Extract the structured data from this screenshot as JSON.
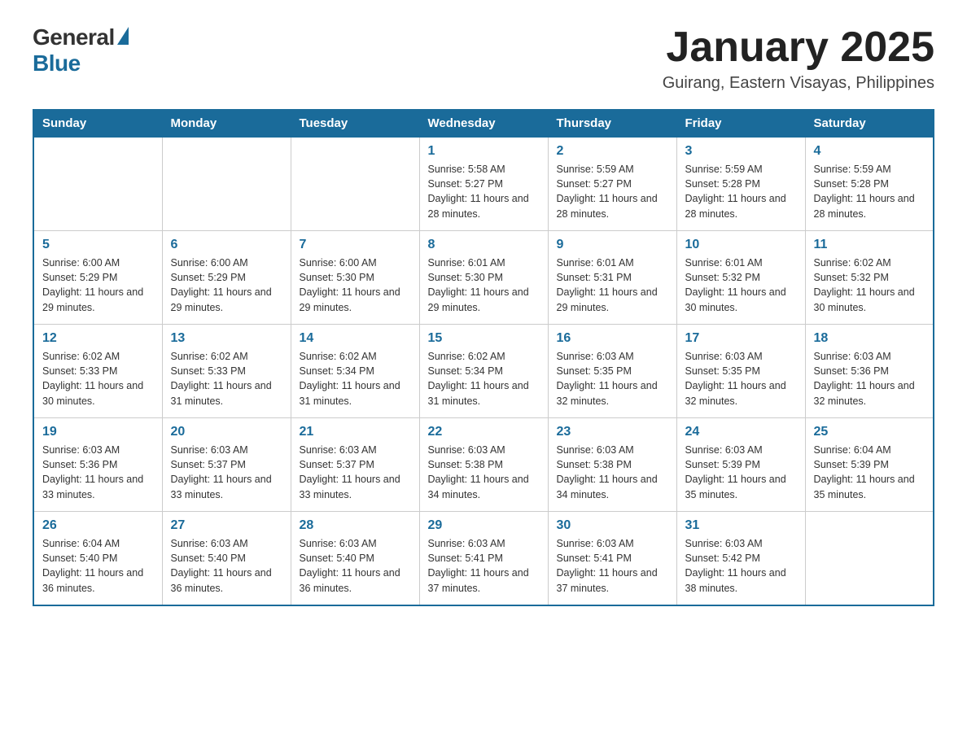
{
  "header": {
    "logo_general": "General",
    "logo_blue": "Blue",
    "title": "January 2025",
    "subtitle": "Guirang, Eastern Visayas, Philippines"
  },
  "days_of_week": [
    "Sunday",
    "Monday",
    "Tuesday",
    "Wednesday",
    "Thursday",
    "Friday",
    "Saturday"
  ],
  "weeks": [
    [
      {
        "day": "",
        "info": ""
      },
      {
        "day": "",
        "info": ""
      },
      {
        "day": "",
        "info": ""
      },
      {
        "day": "1",
        "info": "Sunrise: 5:58 AM\nSunset: 5:27 PM\nDaylight: 11 hours and 28 minutes."
      },
      {
        "day": "2",
        "info": "Sunrise: 5:59 AM\nSunset: 5:27 PM\nDaylight: 11 hours and 28 minutes."
      },
      {
        "day": "3",
        "info": "Sunrise: 5:59 AM\nSunset: 5:28 PM\nDaylight: 11 hours and 28 minutes."
      },
      {
        "day": "4",
        "info": "Sunrise: 5:59 AM\nSunset: 5:28 PM\nDaylight: 11 hours and 28 minutes."
      }
    ],
    [
      {
        "day": "5",
        "info": "Sunrise: 6:00 AM\nSunset: 5:29 PM\nDaylight: 11 hours and 29 minutes."
      },
      {
        "day": "6",
        "info": "Sunrise: 6:00 AM\nSunset: 5:29 PM\nDaylight: 11 hours and 29 minutes."
      },
      {
        "day": "7",
        "info": "Sunrise: 6:00 AM\nSunset: 5:30 PM\nDaylight: 11 hours and 29 minutes."
      },
      {
        "day": "8",
        "info": "Sunrise: 6:01 AM\nSunset: 5:30 PM\nDaylight: 11 hours and 29 minutes."
      },
      {
        "day": "9",
        "info": "Sunrise: 6:01 AM\nSunset: 5:31 PM\nDaylight: 11 hours and 29 minutes."
      },
      {
        "day": "10",
        "info": "Sunrise: 6:01 AM\nSunset: 5:32 PM\nDaylight: 11 hours and 30 minutes."
      },
      {
        "day": "11",
        "info": "Sunrise: 6:02 AM\nSunset: 5:32 PM\nDaylight: 11 hours and 30 minutes."
      }
    ],
    [
      {
        "day": "12",
        "info": "Sunrise: 6:02 AM\nSunset: 5:33 PM\nDaylight: 11 hours and 30 minutes."
      },
      {
        "day": "13",
        "info": "Sunrise: 6:02 AM\nSunset: 5:33 PM\nDaylight: 11 hours and 31 minutes."
      },
      {
        "day": "14",
        "info": "Sunrise: 6:02 AM\nSunset: 5:34 PM\nDaylight: 11 hours and 31 minutes."
      },
      {
        "day": "15",
        "info": "Sunrise: 6:02 AM\nSunset: 5:34 PM\nDaylight: 11 hours and 31 minutes."
      },
      {
        "day": "16",
        "info": "Sunrise: 6:03 AM\nSunset: 5:35 PM\nDaylight: 11 hours and 32 minutes."
      },
      {
        "day": "17",
        "info": "Sunrise: 6:03 AM\nSunset: 5:35 PM\nDaylight: 11 hours and 32 minutes."
      },
      {
        "day": "18",
        "info": "Sunrise: 6:03 AM\nSunset: 5:36 PM\nDaylight: 11 hours and 32 minutes."
      }
    ],
    [
      {
        "day": "19",
        "info": "Sunrise: 6:03 AM\nSunset: 5:36 PM\nDaylight: 11 hours and 33 minutes."
      },
      {
        "day": "20",
        "info": "Sunrise: 6:03 AM\nSunset: 5:37 PM\nDaylight: 11 hours and 33 minutes."
      },
      {
        "day": "21",
        "info": "Sunrise: 6:03 AM\nSunset: 5:37 PM\nDaylight: 11 hours and 33 minutes."
      },
      {
        "day": "22",
        "info": "Sunrise: 6:03 AM\nSunset: 5:38 PM\nDaylight: 11 hours and 34 minutes."
      },
      {
        "day": "23",
        "info": "Sunrise: 6:03 AM\nSunset: 5:38 PM\nDaylight: 11 hours and 34 minutes."
      },
      {
        "day": "24",
        "info": "Sunrise: 6:03 AM\nSunset: 5:39 PM\nDaylight: 11 hours and 35 minutes."
      },
      {
        "day": "25",
        "info": "Sunrise: 6:04 AM\nSunset: 5:39 PM\nDaylight: 11 hours and 35 minutes."
      }
    ],
    [
      {
        "day": "26",
        "info": "Sunrise: 6:04 AM\nSunset: 5:40 PM\nDaylight: 11 hours and 36 minutes."
      },
      {
        "day": "27",
        "info": "Sunrise: 6:03 AM\nSunset: 5:40 PM\nDaylight: 11 hours and 36 minutes."
      },
      {
        "day": "28",
        "info": "Sunrise: 6:03 AM\nSunset: 5:40 PM\nDaylight: 11 hours and 36 minutes."
      },
      {
        "day": "29",
        "info": "Sunrise: 6:03 AM\nSunset: 5:41 PM\nDaylight: 11 hours and 37 minutes."
      },
      {
        "day": "30",
        "info": "Sunrise: 6:03 AM\nSunset: 5:41 PM\nDaylight: 11 hours and 37 minutes."
      },
      {
        "day": "31",
        "info": "Sunrise: 6:03 AM\nSunset: 5:42 PM\nDaylight: 11 hours and 38 minutes."
      },
      {
        "day": "",
        "info": ""
      }
    ]
  ]
}
